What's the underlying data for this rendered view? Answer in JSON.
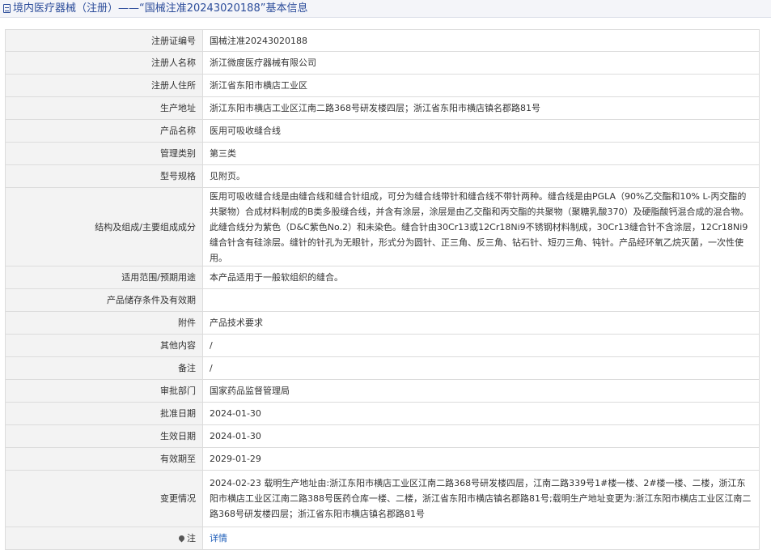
{
  "header": {
    "title": "境内医疗器械（注册）——“国械注准20243020188”基本信息"
  },
  "rows": [
    {
      "label": "注册证编号",
      "value": "国械注准20243020188"
    },
    {
      "label": "注册人名称",
      "value": "浙江微度医疗器械有限公司"
    },
    {
      "label": "注册人住所",
      "value": "浙江省东阳市横店工业区"
    },
    {
      "label": "生产地址",
      "value": "浙江东阳市横店工业区江南二路368号研发楼四层；浙江省东阳市横店镇名郡路81号"
    },
    {
      "label": "产品名称",
      "value": "医用可吸收缝合线"
    },
    {
      "label": "管理类别",
      "value": "第三类"
    },
    {
      "label": "型号规格",
      "value": "见附页。"
    },
    {
      "label": "结构及组成/主要组成成分",
      "value": "医用可吸收缝合线是由缝合线和缝合针组成，可分为缝合线带针和缝合线不带针两种。缝合线是由PGLA（90%乙交酯和10% L-丙交酯的共聚物）合成材料制成的B类多股缝合线，并含有涂层，涂层是由乙交酯和丙交酯的共聚物（聚糖乳酸370）及硬脂酸钙混合成的混合物。此缝合线分为紫色（D&C紫色No.2）和未染色。缝合针由30Cr13或12Cr18Ni9不锈钢材料制成，30Cr13缝合针不含涂层，12Cr18Ni9缝合针含有硅涂层。缝针的针孔为无眼针，形式分为圆针、正三角、反三角、钻石针、短刃三角、钝针。产品经环氧乙烷灭菌，一次性使用。"
    },
    {
      "label": "适用范围/预期用途",
      "value": "本产品适用于一般软组织的缝合。"
    },
    {
      "label": "产品储存条件及有效期",
      "value": ""
    },
    {
      "label": "附件",
      "value": "产品技术要求"
    },
    {
      "label": "其他内容",
      "value": "/"
    },
    {
      "label": "备注",
      "value": "/"
    },
    {
      "label": "审批部门",
      "value": "国家药品监督管理局"
    },
    {
      "label": "批准日期",
      "value": "2024-01-30"
    },
    {
      "label": "生效日期",
      "value": "2024-01-30"
    },
    {
      "label": "有效期至",
      "value": "2029-01-29"
    },
    {
      "label": "变更情况",
      "value": "2024-02-23 载明生产地址由:浙江东阳市横店工业区江南二路368号研发楼四层，江南二路339号1#楼一楼、2#楼一楼、二楼，浙江东阳市横店工业区江南二路388号医药仓库一楼、二楼，浙江省东阳市横店镇名郡路81号;载明生产地址变更为:浙江东阳市横店工业区江南二路368号研发楼四层；浙江省东阳市横店镇名郡路81号"
    },
    {
      "label": "注",
      "value": "详情"
    }
  ]
}
